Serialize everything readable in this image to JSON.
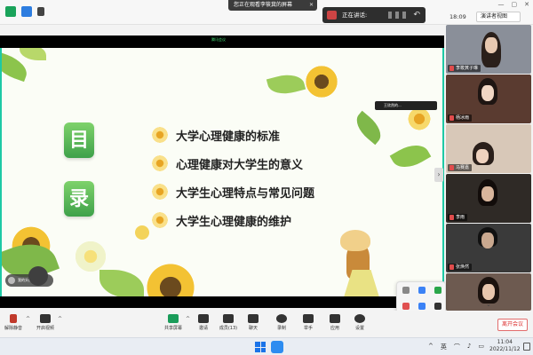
{
  "topbar": {
    "share_banner": "您正在观看李筱萁的屏幕",
    "share_close": "✕",
    "speaking_label": "正在讲话:",
    "clock": "18:09",
    "view_button": "演讲者视图",
    "window_controls": [
      "—",
      "▢",
      "✕"
    ]
  },
  "slide": {
    "cam_label": "腾讯会议",
    "mulu_chars": [
      "目",
      "录"
    ],
    "items": [
      "大学心理健康的标准",
      "心理健康对大学生的意义",
      "大学生心理特点与常见问题",
      "大学生心理健康的维护"
    ]
  },
  "overlays": {
    "float_button": "我的头像",
    "mini_video": "王欣然的..."
  },
  "gallery": {
    "participants": [
      {
        "name": "李筱萁子琳",
        "bg": "#8a8f99"
      },
      {
        "name": "杨冰雨",
        "bg": "#5a3b30"
      },
      {
        "name": "马赛嘉",
        "bg": "#d8c8b8"
      },
      {
        "name": "李雨",
        "bg": "#2f2a26"
      },
      {
        "name": "张焕然",
        "bg": "#3a3a3a"
      },
      {
        "name": "",
        "bg": "#6d5a50"
      }
    ],
    "toggle": "›",
    "more": "⌄"
  },
  "toolbar": {
    "buttons": [
      {
        "label": "解除静音",
        "color": "#c0392b"
      },
      {
        "label": "开启视频",
        "color": "#333333"
      },
      {
        "label": "共享屏幕",
        "color": "#1a9c5a"
      },
      {
        "label": "邀请",
        "color": "#333333"
      },
      {
        "label": "成员(13)",
        "color": "#333333"
      },
      {
        "label": "聊天",
        "color": "#333333"
      },
      {
        "label": "录制",
        "color": "#333333"
      },
      {
        "label": "举手",
        "color": "#333333"
      },
      {
        "label": "应用",
        "color": "#333333"
      },
      {
        "label": "设置",
        "color": "#333333"
      }
    ],
    "leave": "离开会议"
  },
  "taskbar": {
    "tray_items": [
      "^",
      "英",
      "⌒",
      "♪",
      "▭"
    ],
    "time": "11:04",
    "date": "2022/11/12"
  },
  "colors": {
    "accent_green": "#1ec9a5",
    "leave_red": "#e26c6c",
    "win_blue": "#1a73e8"
  }
}
